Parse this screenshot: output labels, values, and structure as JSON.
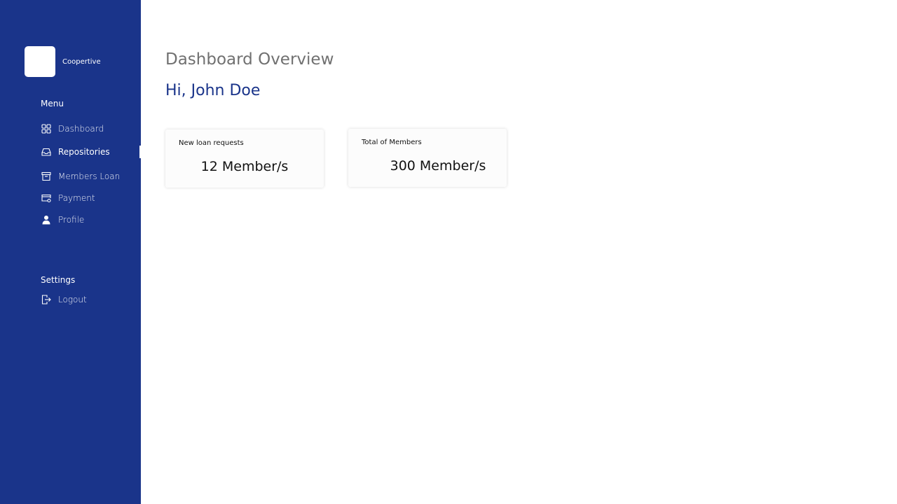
{
  "brand": {
    "name": "Coopertive"
  },
  "sidebar": {
    "menu_title": "Menu",
    "items": [
      {
        "label": "Dashboard",
        "icon": "grid-icon"
      },
      {
        "label": "Repositories",
        "icon": "inbox-icon",
        "active": true
      },
      {
        "label": "Members Loan",
        "icon": "archive-icon"
      },
      {
        "label": "Payment",
        "icon": "payment-card-icon"
      },
      {
        "label": "Profile",
        "icon": "user-icon"
      }
    ],
    "settings_title": "Settings",
    "settings_items": [
      {
        "label": "Logout",
        "icon": "logout-icon"
      }
    ]
  },
  "main": {
    "title": "Dashboard Overview",
    "greeting": "Hi, John Doe",
    "cards": [
      {
        "title": "New loan requests",
        "value": "12 Member/s"
      },
      {
        "title": "Total of Members",
        "value": "300 Member/s"
      }
    ]
  },
  "colors": {
    "sidebar_bg": "#1a348a",
    "accent": "#1a348a",
    "title_gray": "#707070"
  }
}
